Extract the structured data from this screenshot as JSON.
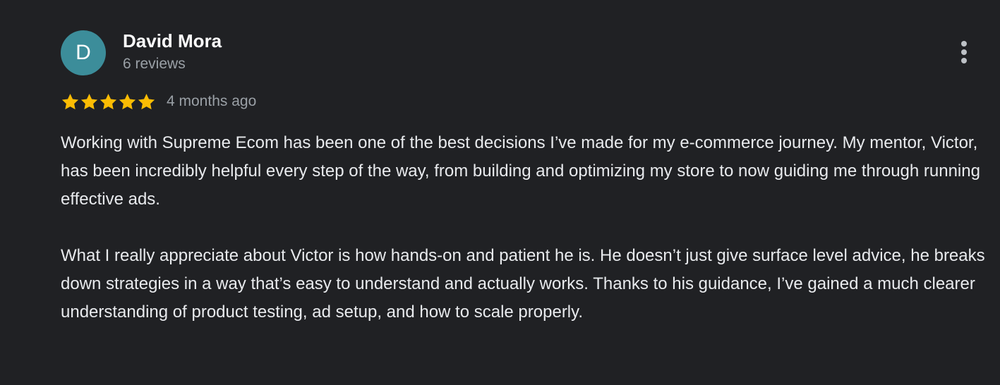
{
  "author": {
    "avatar_letter": "D",
    "name": "David Mora",
    "review_count": "6 reviews"
  },
  "rating": {
    "stars": 5,
    "max": 5,
    "star_color": "#fbbc04",
    "timestamp": "4 months ago"
  },
  "review": {
    "paragraphs": [
      "Working with Supreme Ecom has been one of the best decisions I’ve made for my e-commerce journey. My mentor, Victor, has been incredibly helpful every step of the way, from building and optimizing my store to now guiding me through running effective ads.",
      "What I really appreciate about Victor is how hands-on and patient he is. He doesn’t just give surface level advice, he breaks down strategies in a way that’s easy to understand and actually works. Thanks to his guidance, I’ve gained a much clearer understanding of product testing, ad setup, and how to scale properly."
    ]
  },
  "menu": {
    "icon": "more-vert-icon"
  },
  "colors": {
    "background": "#202124",
    "avatar": "#3c8d9a",
    "secondary_text": "#9aa0a6"
  }
}
